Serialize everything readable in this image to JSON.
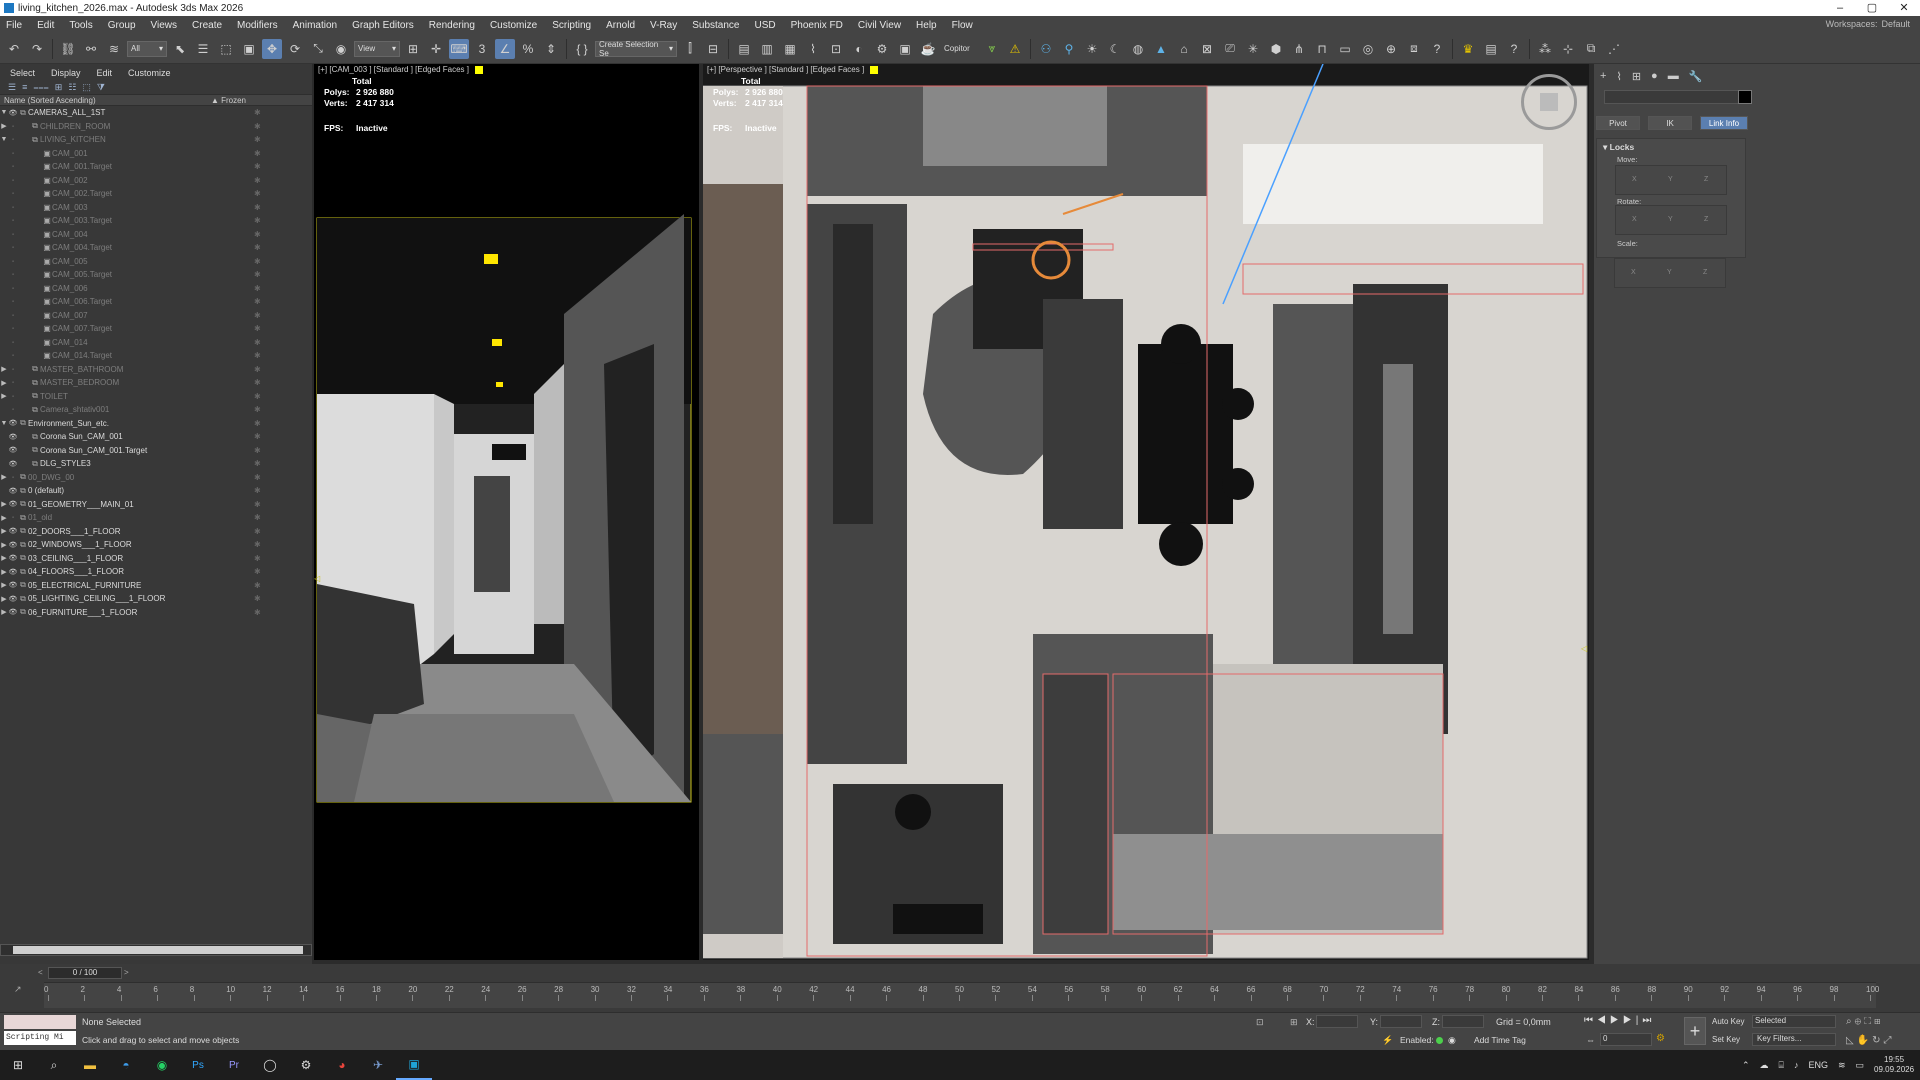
{
  "window": {
    "title": "living_kitchen_2026.max - Autodesk 3ds Max 2026",
    "min": "–",
    "max": "▢",
    "close": "✕"
  },
  "menu": [
    "File",
    "Edit",
    "Tools",
    "Group",
    "Views",
    "Create",
    "Modifiers",
    "Animation",
    "Graph Editors",
    "Rendering",
    "Customize",
    "Scripting",
    "Arnold",
    "V-Ray",
    "Substance",
    "USD",
    "Phoenix FD",
    "Civil View",
    "Help",
    "Flow"
  ],
  "workspaces": {
    "label": "Workspaces:",
    "value": "Default"
  },
  "toolbar": {
    "filter": "All",
    "ref_coord": "View",
    "selection_set": "Create Selection Se",
    "copitor": "Copitor"
  },
  "explorer": {
    "tabs": [
      "Select",
      "Display",
      "Edit",
      "Customize"
    ],
    "col_name": "Name (Sorted Ascending)",
    "col_frozen": "▲ Frozen",
    "rows": [
      {
        "label": "CAMERAS_ALL_1ST",
        "level": 0,
        "arrow": "▼",
        "dim": false,
        "eye": true
      },
      {
        "label": "CHILDREN_ROOM",
        "level": 1,
        "arrow": "▶",
        "dim": true,
        "eye": false
      },
      {
        "label": "LIVING_KITCHEN",
        "level": 1,
        "arrow": "▼",
        "dim": true,
        "eye": false
      },
      {
        "label": "CAM_001",
        "level": 2,
        "arrow": "",
        "dim": true,
        "eye": false
      },
      {
        "label": "CAM_001.Target",
        "level": 2,
        "arrow": "",
        "dim": true,
        "eye": false
      },
      {
        "label": "CAM_002",
        "level": 2,
        "arrow": "",
        "dim": true,
        "eye": false
      },
      {
        "label": "CAM_002.Target",
        "level": 2,
        "arrow": "",
        "dim": true,
        "eye": false
      },
      {
        "label": "CAM_003",
        "level": 2,
        "arrow": "",
        "dim": true,
        "eye": false
      },
      {
        "label": "CAM_003.Target",
        "level": 2,
        "arrow": "",
        "dim": true,
        "eye": false
      },
      {
        "label": "CAM_004",
        "level": 2,
        "arrow": "",
        "dim": true,
        "eye": false
      },
      {
        "label": "CAM_004.Target",
        "level": 2,
        "arrow": "",
        "dim": true,
        "eye": false
      },
      {
        "label": "CAM_005",
        "level": 2,
        "arrow": "",
        "dim": true,
        "eye": false
      },
      {
        "label": "CAM_005.Target",
        "level": 2,
        "arrow": "",
        "dim": true,
        "eye": false
      },
      {
        "label": "CAM_006",
        "level": 2,
        "arrow": "",
        "dim": true,
        "eye": false
      },
      {
        "label": "CAM_006.Target",
        "level": 2,
        "arrow": "",
        "dim": true,
        "eye": false
      },
      {
        "label": "CAM_007",
        "level": 2,
        "arrow": "",
        "dim": true,
        "eye": false
      },
      {
        "label": "CAM_007.Target",
        "level": 2,
        "arrow": "",
        "dim": true,
        "eye": false
      },
      {
        "label": "CAM_014",
        "level": 2,
        "arrow": "",
        "dim": true,
        "eye": false
      },
      {
        "label": "CAM_014.Target",
        "level": 2,
        "arrow": "",
        "dim": true,
        "eye": false
      },
      {
        "label": "MASTER_BATHROOM",
        "level": 1,
        "arrow": "▶",
        "dim": true,
        "eye": false
      },
      {
        "label": "MASTER_BEDROOM",
        "level": 1,
        "arrow": "▶",
        "dim": true,
        "eye": false
      },
      {
        "label": "TOILET",
        "level": 1,
        "arrow": "▶",
        "dim": true,
        "eye": false
      },
      {
        "label": "Camera_shtativ001",
        "level": 1,
        "arrow": "",
        "dim": true,
        "eye": false
      },
      {
        "label": "Environment_Sun_etc.",
        "level": 0,
        "arrow": "▼",
        "dim": false,
        "eye": true
      },
      {
        "label": "Corona Sun_CAM_001",
        "level": 1,
        "arrow": "",
        "dim": false,
        "eye": true
      },
      {
        "label": "Corona Sun_CAM_001.Target",
        "level": 1,
        "arrow": "",
        "dim": false,
        "eye": true
      },
      {
        "label": "DLG_STYLE3",
        "level": 1,
        "arrow": "",
        "dim": false,
        "eye": true
      },
      {
        "label": "00_DWG_00",
        "level": 0,
        "arrow": "▶",
        "dim": true,
        "eye": false
      },
      {
        "label": "0 (default)",
        "level": 0,
        "arrow": "",
        "dim": false,
        "eye": true
      },
      {
        "label": "01_GEOMETRY___MAIN_01",
        "level": 0,
        "arrow": "▶",
        "dim": false,
        "eye": true
      },
      {
        "label": "01_old",
        "level": 0,
        "arrow": "▶",
        "dim": true,
        "eye": false
      },
      {
        "label": "02_DOORS___1_FLOOR",
        "level": 0,
        "arrow": "▶",
        "dim": false,
        "eye": true
      },
      {
        "label": "02_WINDOWS___1_FLOOR",
        "level": 0,
        "arrow": "▶",
        "dim": false,
        "eye": true
      },
      {
        "label": "03_CEILING___1_FLOOR",
        "level": 0,
        "arrow": "▶",
        "dim": false,
        "eye": true
      },
      {
        "label": "04_FLOORS___1_FLOOR",
        "level": 0,
        "arrow": "▶",
        "dim": false,
        "eye": true
      },
      {
        "label": "05_ELECTRICAL_FURNITURE",
        "level": 0,
        "arrow": "▶",
        "dim": false,
        "eye": true
      },
      {
        "label": "05_LIGHTING_CEILING___1_FLOOR",
        "level": 0,
        "arrow": "▶",
        "dim": false,
        "eye": true
      },
      {
        "label": "06_FURNITURE___1_FLOOR",
        "level": 0,
        "arrow": "▶",
        "dim": false,
        "eye": true
      }
    ]
  },
  "viewports": {
    "left": {
      "label": "[+] [CAM_003 ] [Standard ] [Edged Faces ]",
      "stats_total": "Total",
      "polys_label": "Polys:",
      "polys": "2 926 880",
      "verts_label": "Verts:",
      "verts": "2 417 314",
      "fps_label": "FPS:",
      "fps": "Inactive"
    },
    "right": {
      "label": "[+] [Perspective ] [Standard ] [Edged Faces ]",
      "stats_total": "Total",
      "polys_label": "Polys:",
      "polys": "2 926 880",
      "verts_label": "Verts:",
      "verts": "2 417 314",
      "fps_label": "FPS:",
      "fps": "Inactive"
    }
  },
  "command_panel": {
    "buttons": [
      "Pivot",
      "IK",
      "Link Info"
    ],
    "rollout": "Locks",
    "move": "Move:",
    "rotate": "Rotate:",
    "scale": "Scale:",
    "axes": [
      "X",
      "Y",
      "Z"
    ]
  },
  "timeline": {
    "frame": "0 / 100",
    "ticks": [
      0,
      2,
      4,
      6,
      8,
      10,
      12,
      14,
      16,
      18,
      20,
      22,
      24,
      26,
      28,
      30,
      32,
      34,
      36,
      38,
      40,
      42,
      44,
      46,
      48,
      50,
      52,
      54,
      56,
      58,
      60,
      62,
      64,
      66,
      68,
      70,
      72,
      74,
      76,
      78,
      80,
      82,
      84,
      86,
      88,
      90,
      92,
      94,
      96,
      98,
      100
    ]
  },
  "status": {
    "script_label": "Scripting Mi",
    "selection": "None Selected",
    "prompt": "Click and drag to select and move objects",
    "x": "X:",
    "y": "Y:",
    "z": "Z:",
    "grid": "Grid = 0,0mm",
    "enabled": "Enabled:",
    "add_time_tag": "Add Time Tag",
    "auto_key": "Auto Key",
    "set_key": "Set Key",
    "selected": "Selected",
    "key_filters": "Key Filters...",
    "frame_value": "0"
  },
  "taskbar": {
    "lang": "ENG",
    "time": "19:55",
    "date": "09.09.2026"
  },
  "colors": {
    "accent": "#5b7fb0",
    "viewport_bg": "#000000",
    "panel": "#444444"
  }
}
